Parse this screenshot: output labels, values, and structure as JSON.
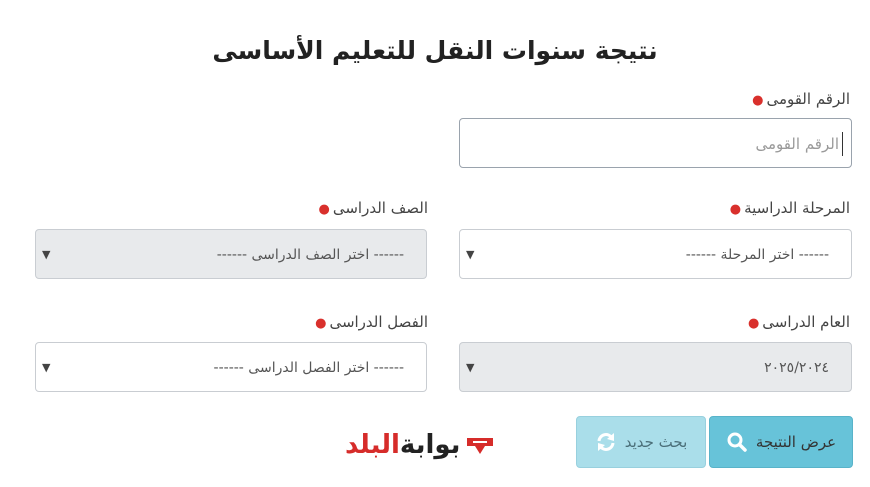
{
  "page": {
    "title": "نتيجة سنوات النقل للتعليم الأساسى"
  },
  "form": {
    "national_id": {
      "label": "الرقم القومى",
      "required_mark": "●",
      "placeholder": "الرقم القومى"
    },
    "stage": {
      "label": "المرحلة الدراسية",
      "required_mark": "●",
      "selected": "------ اختر المرحلة ------"
    },
    "grade": {
      "label": "الصف الدراسى",
      "required_mark": "●",
      "selected": "------ اختر الصف الدراسى ------"
    },
    "year": {
      "label": "العام الدراسى",
      "required_mark": "●",
      "selected": "٢٠٢٥/٢٠٢٤"
    },
    "term": {
      "label": "الفصل الدراسى",
      "required_mark": "●",
      "selected": "------ اختر الفصل الدراسى ------"
    }
  },
  "buttons": {
    "show_result": "عرض النتيجة",
    "new_search": "بحث جديد"
  },
  "logo": {
    "part1": "بوابة",
    "part2": "البلد"
  },
  "colors": {
    "primary_button": "#67c3d9",
    "secondary_button": "#aadeea",
    "required": "#d9302c",
    "logo_red": "#d62c2a"
  }
}
